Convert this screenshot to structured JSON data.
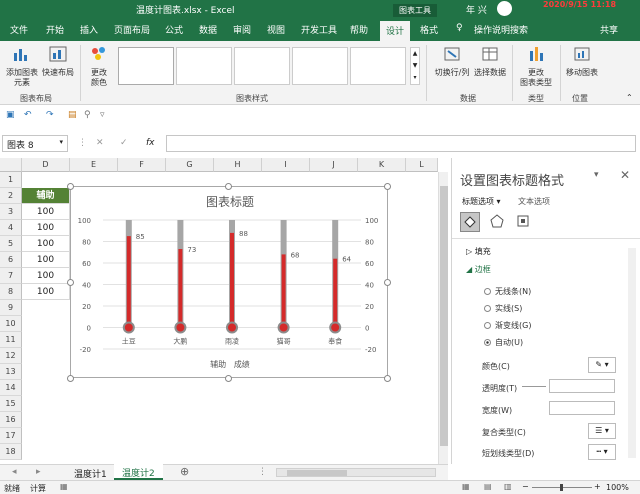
{
  "titlebar": {
    "center": "温度计图表.xlsx  -  Excel",
    "chart_tools": "图表工具",
    "user": "年 兴",
    "datetime": "2020/9/15 11:18"
  },
  "tabs": [
    "文件",
    "开始",
    "插入",
    "页面布局",
    "公式",
    "数据",
    "审阅",
    "视图",
    "开发工具",
    "帮助",
    "设计",
    "格式"
  ],
  "tell_me": "操作说明搜索",
  "share": "共享",
  "ribbon": {
    "add_element": "添加图表\n元素",
    "quick_layout": "快速布局",
    "change_colors": "更改\n颜色",
    "switch_row_col": "切换行/列",
    "select_data": "选择数据",
    "change_type": "更改\n图表类型",
    "move_chart": "移动图表",
    "groups": [
      "图表布局",
      "图表样式",
      "数据",
      "类型",
      "位置"
    ]
  },
  "namebox": "图表 8",
  "fx": "fx",
  "columns": [
    "D",
    "E",
    "F",
    "G",
    "H",
    "I",
    "J",
    "K",
    "L"
  ],
  "rows": [
    "1",
    "2",
    "3",
    "4",
    "5",
    "6",
    "7",
    "8",
    "9",
    "10",
    "11",
    "12",
    "13",
    "14",
    "15",
    "16",
    "17",
    "18"
  ],
  "cells": {
    "header": "辅助",
    "values": [
      "100",
      "100",
      "100",
      "100",
      "100",
      "100"
    ]
  },
  "chart_data": {
    "type": "bar",
    "title": "图表标题",
    "categories": [
      "土豆",
      "大鹏",
      "雨凌",
      "猫哥",
      "奉食"
    ],
    "series": [
      {
        "name": "辅助",
        "values": [
          100,
          100,
          100,
          100,
          100
        ],
        "color": "#a6a6a6"
      },
      {
        "name": "成绩",
        "values": [
          85,
          73,
          88,
          68,
          64
        ],
        "color": "#d42a2a"
      }
    ],
    "ylim": [
      -20,
      100
    ],
    "yticks": [
      "100",
      "80",
      "60",
      "40",
      "20",
      "0",
      "-20"
    ],
    "legend": [
      "辅助",
      "成绩"
    ],
    "legend_position": "bottom"
  },
  "pane": {
    "title": "设置图表标题格式",
    "tab1": "标题选项",
    "tab2": "文本选项",
    "fill": "填充",
    "border": "边框",
    "options": [
      "无线条(N)",
      "实线(S)",
      "渐变线(G)",
      "自动(U)"
    ],
    "selected": "自动(U)",
    "fields": [
      "颜色(C)",
      "透明度(T)",
      "宽度(W)",
      "复合类型(C)",
      "短划线类型(D)"
    ]
  },
  "sheets": [
    "温度计1",
    "温度计2"
  ],
  "active_sheet": "温度计2",
  "status": {
    "ready": "就绪",
    "calc": "计算",
    "zoom": "100%"
  },
  "colors": {
    "excel_green": "#217346",
    "bulb": "#d42a2a",
    "stem": "#a6a6a6"
  }
}
